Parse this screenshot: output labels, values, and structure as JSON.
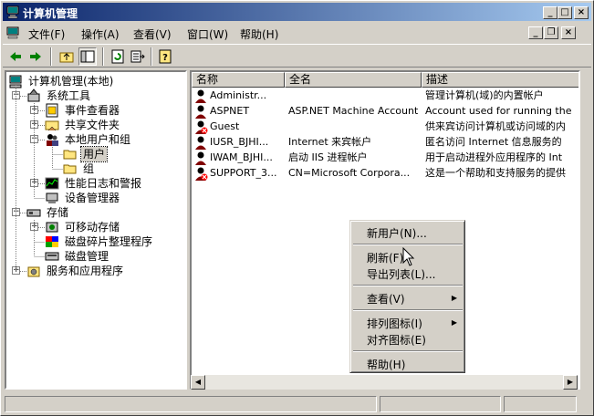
{
  "window": {
    "title": "计算机管理"
  },
  "menu": [
    "文件(F)",
    "操作(A)",
    "查看(V)",
    "窗口(W)",
    "帮助(H)"
  ],
  "caption_buttons": {
    "minimize": "_",
    "maximize": "□",
    "close": "×"
  },
  "mdi_buttons": {
    "minimize": "_",
    "restore": "❐",
    "close": "×"
  },
  "tree": {
    "root": "计算机管理(本地)",
    "system_tools": "系统工具",
    "event_viewer": "事件查看器",
    "shared_folders": "共享文件夹",
    "local_users_groups": "本地用户和组",
    "users": "用户",
    "groups": "组",
    "perf_logs": "性能日志和警报",
    "device_manager": "设备管理器",
    "storage": "存储",
    "removable_storage": "可移动存储",
    "defrag": "磁盘碎片整理程序",
    "disk_mgmt": "磁盘管理",
    "services_apps": "服务和应用程序",
    "expander_plus": "+",
    "expander_minus": "−"
  },
  "list": {
    "headers": {
      "name": "名称",
      "fullname": "全名",
      "desc": "描述"
    },
    "rows": [
      {
        "name": "Administr...",
        "fullname": "",
        "desc": "管理计算机(域)的内置帐户"
      },
      {
        "name": "ASPNET",
        "fullname": "ASP.NET Machine Account",
        "desc": "Account used for running the"
      },
      {
        "name": "Guest",
        "fullname": "",
        "desc": "供来宾访问计算机或访问域的内"
      },
      {
        "name": "IUSR_BJHI...",
        "fullname": "Internet 来宾帐户",
        "desc": "匿名访问 Internet 信息服务的"
      },
      {
        "name": "IWAM_BJHI...",
        "fullname": "启动 IIS 进程帐户",
        "desc": "用于启动进程外应用程序的 Int"
      },
      {
        "name": "SUPPORT_3...",
        "fullname": "CN=Microsoft Corpora...",
        "desc": "这是一个帮助和支持服务的提供"
      }
    ]
  },
  "context_menu": {
    "new_user": "新用户(N)...",
    "refresh": "刷新(F)",
    "export_list": "导出列表(L)...",
    "view": "查看(V)",
    "arrange_icons": "排列图标(I)",
    "line_up_icons": "对齐图标(E)",
    "help": "帮助(H)",
    "submenu_arrow": "▶"
  },
  "scroll": {
    "left": "◀",
    "right": "▶"
  }
}
